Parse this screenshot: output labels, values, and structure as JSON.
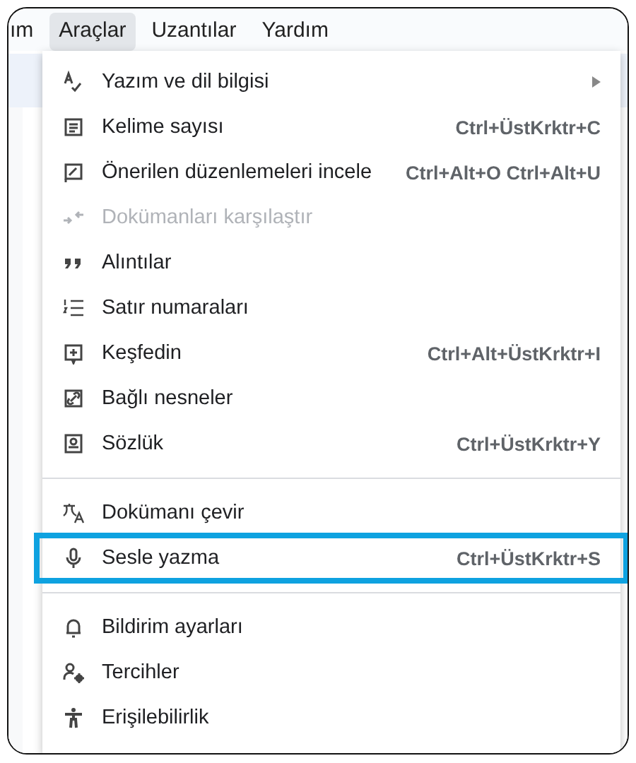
{
  "menubar": [
    {
      "label": "ım",
      "selected": false
    },
    {
      "label": "Araçlar",
      "selected": true
    },
    {
      "label": "Uzantılar",
      "selected": false
    },
    {
      "label": "Yardım",
      "selected": false
    }
  ],
  "menu": {
    "groups": [
      [
        {
          "label": "Yazım ve dil bilgisi",
          "submenu": true,
          "disabled": false,
          "highlighted": false
        },
        {
          "label": "Kelime sayısı",
          "shortcut": "Ctrl+ÜstKrktr+C",
          "submenu": false,
          "disabled": false,
          "highlighted": false
        },
        {
          "label": "Önerilen düzenlemeleri incele",
          "shortcut": "Ctrl+Alt+O Ctrl+Alt+U",
          "submenu": false,
          "disabled": false,
          "highlighted": false
        },
        {
          "label": "Dokümanları karşılaştır",
          "submenu": false,
          "disabled": true,
          "highlighted": false
        },
        {
          "label": "Alıntılar",
          "submenu": false,
          "disabled": false,
          "highlighted": false
        },
        {
          "label": "Satır numaraları",
          "submenu": false,
          "disabled": false,
          "highlighted": false
        },
        {
          "label": "Keşfedin",
          "shortcut": "Ctrl+Alt+ÜstKrktr+I",
          "submenu": false,
          "disabled": false,
          "highlighted": false
        },
        {
          "label": "Bağlı nesneler",
          "submenu": false,
          "disabled": false,
          "highlighted": false
        },
        {
          "label": "Sözlük",
          "shortcut": "Ctrl+ÜstKrktr+Y",
          "submenu": false,
          "disabled": false,
          "highlighted": false
        }
      ],
      [
        {
          "label": "Dokümanı çevir",
          "submenu": false,
          "disabled": false,
          "highlighted": false
        },
        {
          "label": "Sesle yazma",
          "shortcut": "Ctrl+ÜstKrktr+S",
          "submenu": false,
          "disabled": false,
          "highlighted": true
        }
      ],
      [
        {
          "label": "Bildirim ayarları",
          "submenu": false,
          "disabled": false,
          "highlighted": false
        },
        {
          "label": "Tercihler",
          "submenu": false,
          "disabled": false,
          "highlighted": false
        },
        {
          "label": "Erişilebilirlik",
          "submenu": false,
          "disabled": false,
          "highlighted": false
        }
      ]
    ]
  }
}
